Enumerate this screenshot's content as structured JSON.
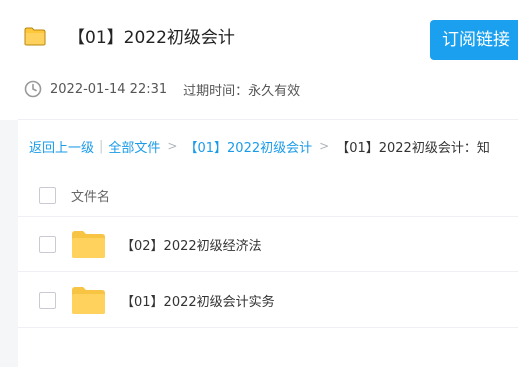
{
  "header": {
    "title": "【01】2022初级会计",
    "subscribe_label": "订阅链接",
    "folder_icon": "folder-icon",
    "accent_color": "#1aa0ee"
  },
  "meta": {
    "clock_icon": "clock-icon",
    "date": "2022-01-14 22:31",
    "expiry": "过期时间：永久有效"
  },
  "breadcrumb": {
    "back": "返回上一级",
    "sep": "|",
    "all_files": "全部文件",
    "arrow": ">",
    "level1": "【01】2022初级会计",
    "current": "【01】2022初级会计：知"
  },
  "table": {
    "column_name": "文件名",
    "rows": [
      {
        "name": "【02】2022初级经济法",
        "icon": "folder-icon"
      },
      {
        "name": "【01】2022初级会计实务",
        "icon": "folder-icon"
      }
    ]
  },
  "colors": {
    "folder": "#ffd25e",
    "link": "#1a9be8",
    "checkbox_border": "#c8ccd2"
  }
}
